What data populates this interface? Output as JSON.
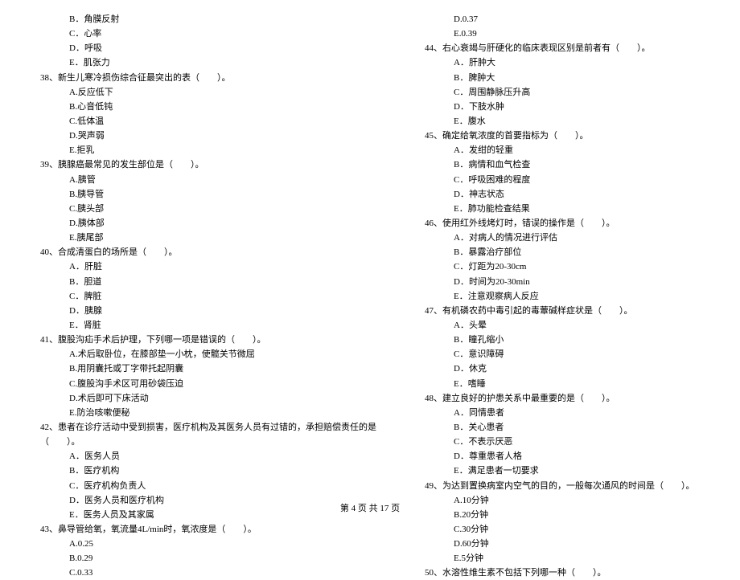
{
  "left": [
    {
      "cls": "opt",
      "t": "B．角膜反射"
    },
    {
      "cls": "opt",
      "t": "C．心率"
    },
    {
      "cls": "opt",
      "t": "D．呼吸"
    },
    {
      "cls": "opt",
      "t": "E．肌张力"
    },
    {
      "cls": "q",
      "t": "38、新生儿寒冷损伤综合征最突出的表（　　）。"
    },
    {
      "cls": "opt",
      "t": "A.反应低下"
    },
    {
      "cls": "opt",
      "t": "B.心音低钝"
    },
    {
      "cls": "opt",
      "t": "C.低体温"
    },
    {
      "cls": "opt",
      "t": "D.哭声弱"
    },
    {
      "cls": "opt",
      "t": "E.拒乳"
    },
    {
      "cls": "q",
      "t": "39、胰腺癌最常见的发生部位是（　　）。"
    },
    {
      "cls": "opt",
      "t": "A.胰管"
    },
    {
      "cls": "opt",
      "t": "B.胰导管"
    },
    {
      "cls": "opt",
      "t": "C.胰头部"
    },
    {
      "cls": "opt",
      "t": "D.胰体部"
    },
    {
      "cls": "opt",
      "t": "E.胰尾部"
    },
    {
      "cls": "q",
      "t": "40、合成清蛋白的场所是（　　）。"
    },
    {
      "cls": "opt",
      "t": "A．肝脏"
    },
    {
      "cls": "opt",
      "t": "B．胆道"
    },
    {
      "cls": "opt",
      "t": "C．脾脏"
    },
    {
      "cls": "opt",
      "t": "D．胰腺"
    },
    {
      "cls": "opt",
      "t": "E．肾脏"
    },
    {
      "cls": "q",
      "t": "41、腹股沟疝手术后护理，下列哪一项是错误的（　　）。"
    },
    {
      "cls": "opt",
      "t": "A.术后取卧位，在膝部垫一小枕，使髋关节微屈"
    },
    {
      "cls": "opt",
      "t": "B.用阴囊托或丁字带托起阴囊"
    },
    {
      "cls": "opt",
      "t": "C.腹股沟手术区可用砂袋压迫"
    },
    {
      "cls": "opt",
      "t": "D.术后即可下床活动"
    },
    {
      "cls": "opt",
      "t": "E.防治咳嗽便秘"
    },
    {
      "cls": "q",
      "t": "42、患者在诊疗活动中受到损害，医疗机构及其医务人员有过错的，承担赔偿责任的是"
    },
    {
      "cls": "q",
      "t": "（　　）。"
    },
    {
      "cls": "opt",
      "t": "A．医务人员"
    },
    {
      "cls": "opt",
      "t": "B．医疗机构"
    },
    {
      "cls": "opt",
      "t": "C．医疗机构负责人"
    },
    {
      "cls": "opt",
      "t": "D．医务人员和医疗机构"
    },
    {
      "cls": "opt",
      "t": "E．医务人员及其家属"
    },
    {
      "cls": "q",
      "t": "43、鼻导管给氧，氧流量4L/min时，氧浓度是（　　）。"
    },
    {
      "cls": "opt",
      "t": "A.0.25"
    },
    {
      "cls": "opt",
      "t": "B.0.29"
    },
    {
      "cls": "opt",
      "t": "C.0.33"
    }
  ],
  "right": [
    {
      "cls": "opt",
      "t": "D.0.37"
    },
    {
      "cls": "opt",
      "t": "E.0.39"
    },
    {
      "cls": "q",
      "t": "44、右心衰竭与肝硬化的临床表现区别是前者有（　　）。"
    },
    {
      "cls": "opt",
      "t": "A．肝肿大"
    },
    {
      "cls": "opt",
      "t": "B．脾肿大"
    },
    {
      "cls": "opt",
      "t": "C．周围静脉压升高"
    },
    {
      "cls": "opt",
      "t": "D．下肢水肿"
    },
    {
      "cls": "opt",
      "t": "E．腹水"
    },
    {
      "cls": "q",
      "t": "45、确定给氧浓度的首要指标为（　　）。"
    },
    {
      "cls": "opt",
      "t": "A．发绀的轻重"
    },
    {
      "cls": "opt",
      "t": "B．病情和血气检查"
    },
    {
      "cls": "opt",
      "t": "C．呼吸困难的程度"
    },
    {
      "cls": "opt",
      "t": "D．神志状态"
    },
    {
      "cls": "opt",
      "t": "E．肺功能检查结果"
    },
    {
      "cls": "q",
      "t": "46、使用红外线烤灯时，错误的操作是（　　）。"
    },
    {
      "cls": "opt",
      "t": "A．对病人的情况进行评估"
    },
    {
      "cls": "opt",
      "t": "B．暴露治疗部位"
    },
    {
      "cls": "opt",
      "t": "C．灯距为20-30cm"
    },
    {
      "cls": "opt",
      "t": "D．时间为20-30min"
    },
    {
      "cls": "opt",
      "t": "E．注意观察病人反应"
    },
    {
      "cls": "q",
      "t": "47、有机磷农药中毒引起的毒蕈碱样症状是（　　）。"
    },
    {
      "cls": "opt",
      "t": "A．头晕"
    },
    {
      "cls": "opt",
      "t": "B．瞳孔缩小"
    },
    {
      "cls": "opt",
      "t": "C．意识障碍"
    },
    {
      "cls": "opt",
      "t": "D．休克"
    },
    {
      "cls": "opt",
      "t": "E．嗜睡"
    },
    {
      "cls": "q",
      "t": "48、建立良好的护患关系中最重要的是（　　）。"
    },
    {
      "cls": "opt",
      "t": "A．同情患者"
    },
    {
      "cls": "opt",
      "t": "B．关心患者"
    },
    {
      "cls": "opt",
      "t": "C．不表示厌恶"
    },
    {
      "cls": "opt",
      "t": "D．尊重患者人格"
    },
    {
      "cls": "opt",
      "t": "E．满足患者一切要求"
    },
    {
      "cls": "q",
      "t": "49、为达到置换病室内空气的目的，一般每次通风的时间是（　　）。"
    },
    {
      "cls": "opt",
      "t": "A.10分钟"
    },
    {
      "cls": "opt",
      "t": "B.20分钟"
    },
    {
      "cls": "opt",
      "t": "C.30分钟"
    },
    {
      "cls": "opt",
      "t": "D.60分钟"
    },
    {
      "cls": "opt",
      "t": "E.5分钟"
    },
    {
      "cls": "q",
      "t": "50、水溶性维生素不包括下列哪一种（　　）。"
    }
  ],
  "footer": "第 4 页 共 17 页"
}
